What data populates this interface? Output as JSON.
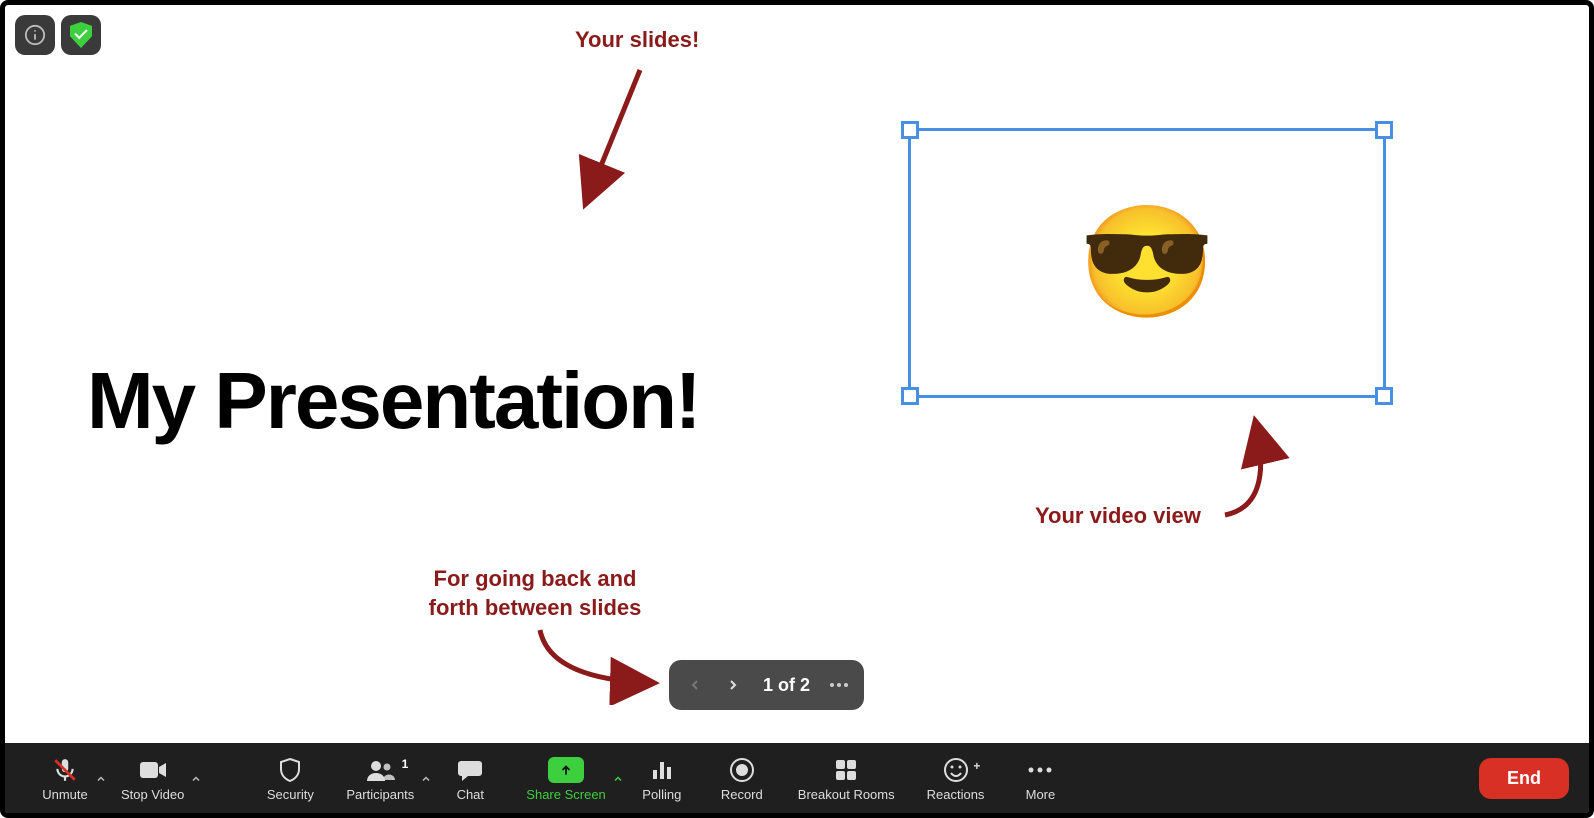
{
  "top": {
    "info_icon": "info-icon",
    "shield_icon": "shield-check-icon"
  },
  "slide": {
    "title": "My Presentation!"
  },
  "annotations": {
    "slides": "Your slides!",
    "nav_line1": "For going back and",
    "nav_line2": "forth between slides",
    "video": "Your video view"
  },
  "video": {
    "avatar_emoji": "😎"
  },
  "slide_nav": {
    "counter": "1 of 2"
  },
  "toolbar": {
    "unmute": "Unmute",
    "stop_video": "Stop Video",
    "security": "Security",
    "participants": "Participants",
    "participants_count": "1",
    "chat": "Chat",
    "share_screen": "Share Screen",
    "polling": "Polling",
    "record": "Record",
    "breakout": "Breakout Rooms",
    "reactions": "Reactions",
    "more": "More",
    "end": "End"
  }
}
